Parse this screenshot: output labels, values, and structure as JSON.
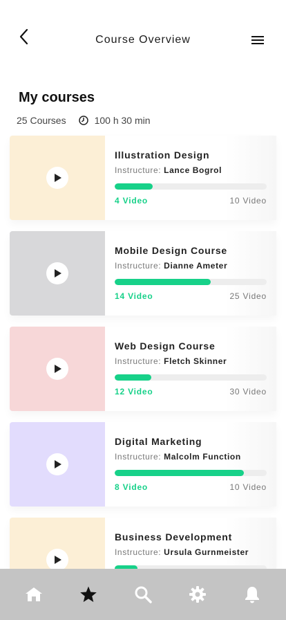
{
  "header": {
    "title": "Course Overview",
    "back_icon": "chevron-left-icon",
    "menu_icon": "hamburger-menu-icon"
  },
  "summary": {
    "title": "My courses",
    "course_count": "25 Courses",
    "duration": "100 h 30 min",
    "duration_icon": "clock-icon"
  },
  "courses": [
    {
      "name": "Illustration Design",
      "instructor_label": "Instructure:",
      "instructor": "Lance Bogrol",
      "done_label": "4 Video",
      "total_label": "10 Video",
      "progress": 0.25,
      "color": "#fcefd6"
    },
    {
      "name": "Mobile Design Course",
      "instructor_label": "Instructure:",
      "instructor": "Dianne Ameter",
      "done_label": "14 Video",
      "total_label": "25 Video",
      "progress": 0.63,
      "color": "#d8d8da"
    },
    {
      "name": "Web Design Course",
      "instructor_label": "Instructure:",
      "instructor": "Fletch Skinner",
      "done_label": "12 Video",
      "total_label": "30 Video",
      "progress": 0.24,
      "color": "#f7d7d8"
    },
    {
      "name": "Digital Marketing",
      "instructor_label": "Instructure:",
      "instructor": "Malcolm Function",
      "done_label": "8 Video",
      "total_label": "10 Video",
      "progress": 0.85,
      "color": "#e2dcfd"
    },
    {
      "name": "Business Development",
      "instructor_label": "Instructure:",
      "instructor": "Ursula Gurnmeister",
      "done_label": "",
      "total_label": "",
      "progress": 0.15,
      "color": "#fcefd6"
    }
  ],
  "bottom_nav": [
    {
      "icon": "home-icon",
      "active": false
    },
    {
      "icon": "star-icon",
      "active": true
    },
    {
      "icon": "search-icon",
      "active": false
    },
    {
      "icon": "gear-icon",
      "active": false
    },
    {
      "icon": "bell-icon",
      "active": false
    }
  ],
  "colors": {
    "accent": "#17d189",
    "nav_bg": "#c4c4c4",
    "nav_icon": "#ffffff",
    "nav_icon_active": "#111111"
  }
}
